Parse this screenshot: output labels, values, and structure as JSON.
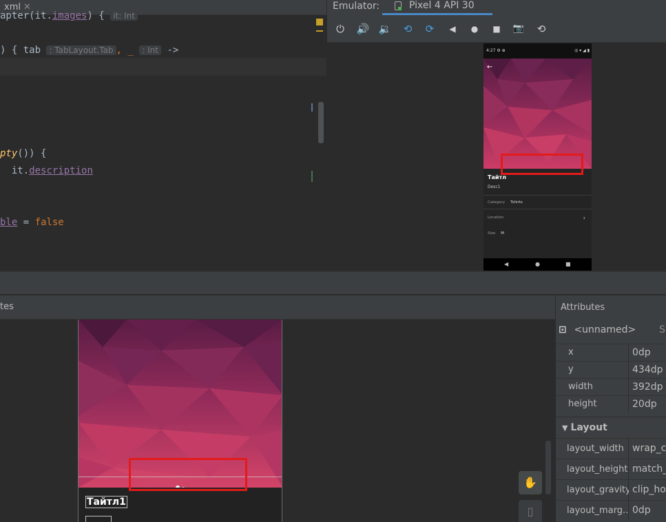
{
  "editor": {
    "tab_label": "xml",
    "close_glyph": "✕",
    "lines": {
      "l1_a": "apter(",
      "l1_b": "it",
      "l1_c": ".",
      "l1_d": "images",
      "l1_e": ") {",
      "l1_hint": "it: Int",
      "l2_a": ") { tab",
      "l2_hint": ": TabLayout.Tab",
      "l2_b": ", _",
      "l2_hint2": ": Int",
      "l2_c": "->",
      "l3_a": "pty",
      "l3_b": "()) {",
      "l4_a": "it.",
      "l4_b": "description",
      "l5_a": "ble",
      "l5_b": " = ",
      "l5_c": "false"
    }
  },
  "emulator": {
    "label": "Emulator:",
    "device_tab": "Pixel 4 API 30",
    "toolbar": [
      "power-icon",
      "volume-up-icon",
      "volume-down-icon",
      "rotate-left-icon",
      "rotate-right-icon",
      "back-icon",
      "home-icon",
      "overview-icon",
      "camera-icon",
      "snapshot-icon"
    ],
    "toolbar_glyphs": [
      "⏻",
      "🔊",
      "🔉",
      "⟲",
      "⟳",
      "◀",
      "●",
      "■",
      "📷",
      "⟲"
    ],
    "phone": {
      "time": "4:27 ⚙ ⊕",
      "status_right": "◎ ▾ ◢ ▮",
      "back_arrow": "←",
      "title": "Тайтл",
      "subtitle": "Desc1",
      "category_label": "Category",
      "category_value": "Tshirts",
      "location_label": "Location",
      "chevron": "›",
      "size_label": "Size",
      "size_value": "M",
      "nav_back": "◀",
      "nav_home": "●",
      "nav_recent": "■"
    }
  },
  "bottom": {
    "panel_label": "tes",
    "preview": {
      "title": "Тайтл1"
    },
    "tools": {
      "pan_glyph": "✋",
      "layer_glyph": "▯"
    }
  },
  "attributes": {
    "title": "Attributes",
    "component_name": "<unnamed>",
    "trailing": "Sl",
    "component_glyph": "⊡",
    "rows": [
      {
        "key": "x",
        "value": "0dp"
      },
      {
        "key": "y",
        "value": "434dp"
      },
      {
        "key": "width",
        "value": "392dp"
      },
      {
        "key": "height",
        "value": "20dp"
      }
    ],
    "layout_section": "Layout",
    "layout_toggle": "▼",
    "layout_rows": [
      {
        "key": "layout_width",
        "value": "wrap_c"
      },
      {
        "key": "layout_height",
        "value": "match_"
      },
      {
        "key": "layout_gravity",
        "value": "clip_ho"
      },
      {
        "key": "layout_marg...",
        "value": "0dp"
      }
    ]
  },
  "colors": {
    "highlight_red": "#e41a1a",
    "accent_blue": "#4a88c7",
    "hero_magenta": "#b8335c"
  }
}
